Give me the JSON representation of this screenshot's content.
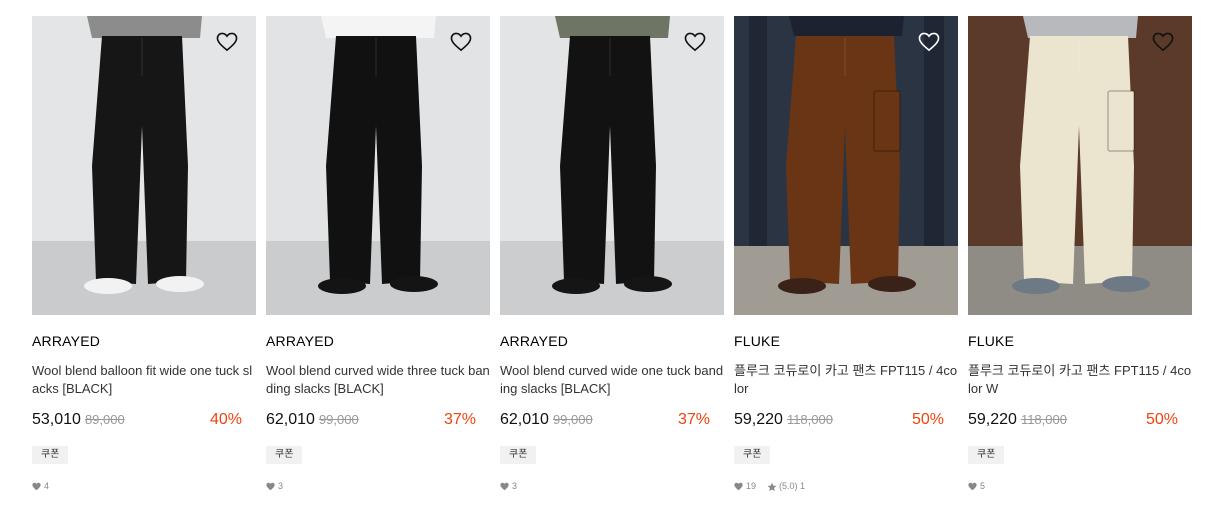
{
  "products": [
    {
      "brand": "ARRAYED",
      "title": "Wool blend balloon fit wide one tuck slacks [BLACK]",
      "price": "53,010",
      "original_price": "89,000",
      "discount": "40%",
      "coupon": "쿠폰",
      "likes": "4",
      "image": {
        "bg": "#e3e5e6",
        "floor": "#c9cbcc",
        "pants": "#161616",
        "top": "#8c8c8c",
        "shoes": "#f2f2f2"
      }
    },
    {
      "brand": "ARRAYED",
      "title": "Wool blend curved wide three tuck banding slacks [BLACK]",
      "price": "62,010",
      "original_price": "99,000",
      "discount": "37%",
      "coupon": "쿠폰",
      "likes": "3",
      "image": {
        "bg": "#e1e3e4",
        "floor": "#cacccd",
        "pants": "#111111",
        "top": "#f4f4f4",
        "shoes": "#141414"
      }
    },
    {
      "brand": "ARRAYED",
      "title": "Wool blend curved wide one tuck banding slacks [BLACK]",
      "price": "62,010",
      "original_price": "99,000",
      "discount": "37%",
      "coupon": "쿠폰",
      "likes": "3",
      "image": {
        "bg": "#e2e4e5",
        "floor": "#cbcdce",
        "pants": "#121212",
        "top": "#6e7564",
        "shoes": "#151515"
      }
    },
    {
      "brand": "FLUKE",
      "title": "플루크 코듀로이 카고 팬츠 FPT115 / 4color",
      "price": "59,220",
      "original_price": "118,000",
      "discount": "50%",
      "coupon": "쿠폰",
      "likes": "19",
      "rating": "(5.0) 1",
      "image": {
        "bg": "#2a3442",
        "floor": "#a09b93",
        "pants": "#6a3515",
        "top": "#1d2230",
        "shoes": "#3a2218"
      }
    },
    {
      "brand": "FLUKE",
      "title": "플루크 코듀로이 카고 팬츠 FPT115 / 4color W",
      "price": "59,220",
      "original_price": "118,000",
      "discount": "50%",
      "coupon": "쿠폰",
      "likes": "5",
      "image": {
        "bg": "#5b3a2a",
        "floor": "#8f8c86",
        "pants": "#ebe4cf",
        "top": "#b7b9bd",
        "shoes": "#6d7a86"
      }
    }
  ],
  "colors": {
    "discount": "#f0420f",
    "original_price": "#999999",
    "coupon_bg": "#f1f1f1"
  },
  "icons": {
    "wishlist": "heart-outline-icon",
    "likes": "heart-icon",
    "rating": "star-icon"
  }
}
